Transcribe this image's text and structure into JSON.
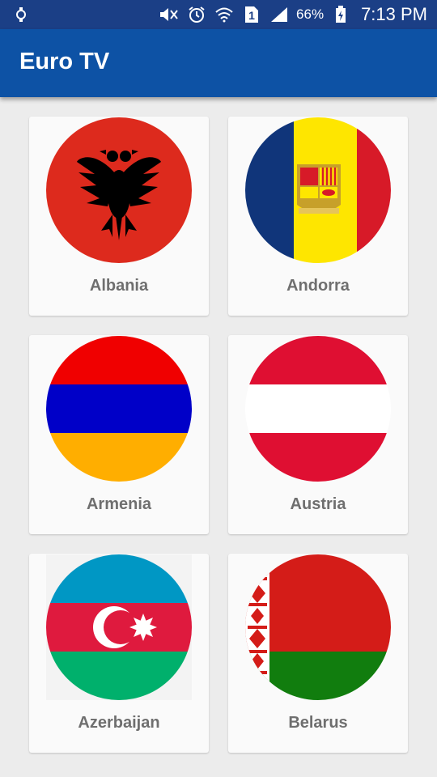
{
  "status_bar": {
    "battery_percent": "66%",
    "time": "7:13 PM",
    "sim_label": "1",
    "icons": [
      "watch-icon",
      "mute-icon",
      "alarm-icon",
      "wifi-icon",
      "sim-icon",
      "signal-icon",
      "battery-charging-icon"
    ]
  },
  "app_bar": {
    "title": "Euro TV"
  },
  "countries": [
    {
      "name": "Albania",
      "flag_icon": "albania-flag-icon"
    },
    {
      "name": "Andorra",
      "flag_icon": "andorra-flag-icon"
    },
    {
      "name": "Armenia",
      "flag_icon": "armenia-flag-icon"
    },
    {
      "name": "Austria",
      "flag_icon": "austria-flag-icon"
    },
    {
      "name": "Azerbaijan",
      "flag_icon": "azerbaijan-flag-icon"
    },
    {
      "name": "Belarus",
      "flag_icon": "belarus-flag-icon"
    }
  ],
  "colors": {
    "status_bar": "#1b3f86",
    "app_bar": "#0d52a5",
    "background": "#ececec",
    "card": "#fafafa",
    "label": "#6f6f6f"
  }
}
